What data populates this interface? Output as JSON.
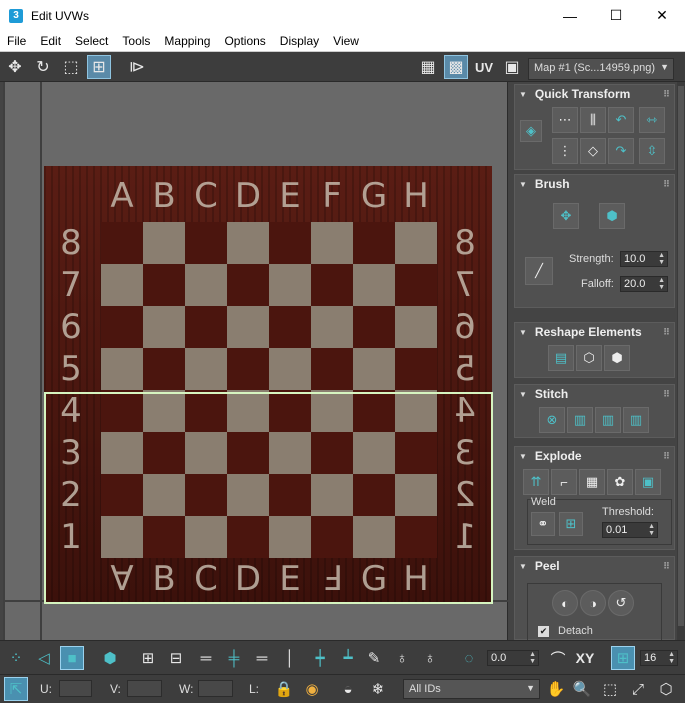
{
  "window": {
    "app_icon_text": "3",
    "title": "Edit UVWs",
    "minimize": "—",
    "maximize": "☐",
    "close": "✕"
  },
  "menu": [
    "File",
    "Edit",
    "Select",
    "Tools",
    "Mapping",
    "Options",
    "Display",
    "View"
  ],
  "toolbar_top": {
    "uv_label": "UV",
    "map_dropdown": "Map #1 (Sc...14959.png)"
  },
  "board": {
    "files_top": [
      "A",
      "B",
      "C",
      "D",
      "E",
      "F",
      "G",
      "H"
    ],
    "files_bottom": [
      "∀",
      "B",
      "C",
      "D",
      "E",
      "Ⅎ",
      "G",
      "H"
    ],
    "ranks_left": [
      "8",
      "7",
      "6",
      "5",
      "4",
      "3",
      "2",
      "1"
    ],
    "ranks_right": [
      "8",
      "7",
      "6",
      "5",
      "4",
      "3",
      "2",
      "1"
    ]
  },
  "panel": {
    "quick_transform": {
      "title": "Quick Transform"
    },
    "brush": {
      "title": "Brush",
      "strength_label": "Strength:",
      "strength_value": "10.0",
      "falloff_label": "Falloff:",
      "falloff_value": "20.0"
    },
    "reshape": {
      "title": "Reshape Elements"
    },
    "stitch": {
      "title": "Stitch"
    },
    "explode": {
      "title": "Explode",
      "weld_label": "Weld",
      "threshold_label": "Threshold:",
      "threshold_value": "0.01"
    },
    "peel": {
      "title": "Peel",
      "detach_label": "Detach",
      "detach_checked": true
    }
  },
  "toolbar_bottom": {
    "rotate_value": "0.0",
    "xy_label": "XY",
    "grid_value": "16",
    "u_label": "U:",
    "v_label": "V:",
    "w_label": "W:",
    "l_label": "L:",
    "ids_dropdown": "All IDs"
  }
}
